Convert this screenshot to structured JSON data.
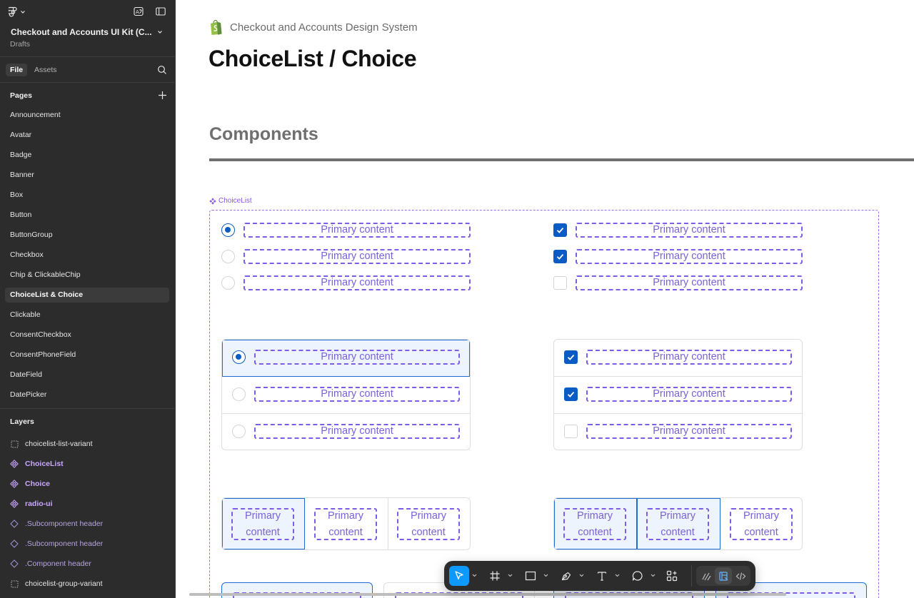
{
  "file": {
    "title": "Checkout and Accounts UI Kit (C...",
    "location": "Drafts"
  },
  "tabs": [
    {
      "label": "File"
    },
    {
      "label": "Assets"
    }
  ],
  "pages": {
    "heading": "Pages",
    "items": [
      {
        "label": "Announcement"
      },
      {
        "label": "Avatar"
      },
      {
        "label": "Badge"
      },
      {
        "label": "Banner"
      },
      {
        "label": "Box"
      },
      {
        "label": "Button"
      },
      {
        "label": "ButtonGroup"
      },
      {
        "label": "Checkbox"
      },
      {
        "label": "Chip & ClickableChip"
      },
      {
        "label": "ChoiceList & Choice"
      },
      {
        "label": "Clickable"
      },
      {
        "label": "ConsentCheckbox"
      },
      {
        "label": "ConsentPhoneField"
      },
      {
        "label": "DateField"
      },
      {
        "label": "DatePicker"
      }
    ],
    "selected": "ChoiceList & Choice"
  },
  "layers": {
    "heading": "Layers",
    "items": [
      {
        "label": "choicelist-list-variant",
        "kind": "frame"
      },
      {
        "label": "ChoiceList",
        "kind": "component"
      },
      {
        "label": "Choice",
        "kind": "component"
      },
      {
        "label": "radio-ui",
        "kind": "component"
      },
      {
        "label": ".Subcomponent header",
        "kind": "instance"
      },
      {
        "label": ".Subcomponent header",
        "kind": "instance"
      },
      {
        "label": ".Component header",
        "kind": "instance"
      },
      {
        "label": "choicelist-group-variant",
        "kind": "frame"
      }
    ]
  },
  "canvas": {
    "brand": "Checkout and Accounts Design System",
    "title": "ChoiceList / Choice",
    "section": "Components",
    "component_label": "ChoiceList",
    "primary": "Primary content",
    "primary_line1": "Primary",
    "primary_line2": "content"
  },
  "colors": {
    "accent": "#0a5cc4",
    "component_purple": "#a66cf0",
    "toolbar_active": "#0d99ff",
    "sidebar_bg": "#2c2c2c"
  },
  "toolbar": {
    "tools": [
      {
        "name": "move-tool",
        "icon": "cursor-icon",
        "active": true
      },
      {
        "name": "frame-tool",
        "icon": "hash-icon"
      },
      {
        "name": "shape-tool",
        "icon": "rectangle-icon"
      },
      {
        "name": "pen-tool",
        "icon": "pen-icon"
      },
      {
        "name": "text-tool",
        "icon": "text-icon"
      },
      {
        "name": "comment-tool",
        "icon": "comment-icon"
      },
      {
        "name": "actions-tool",
        "icon": "actions-icon"
      }
    ],
    "dev": [
      {
        "icon": "draw-icon"
      },
      {
        "icon": "design-icon",
        "active": true
      },
      {
        "icon": "code-icon"
      }
    ]
  }
}
